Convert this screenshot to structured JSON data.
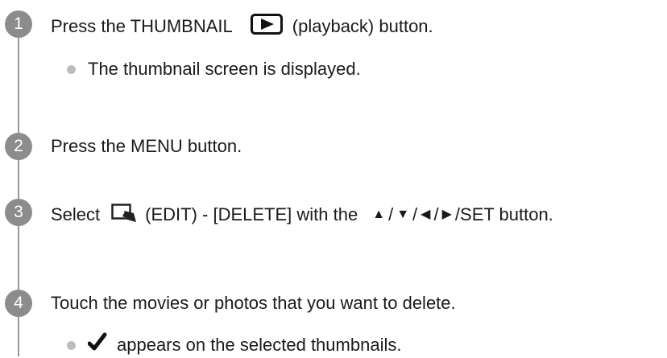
{
  "steps": [
    {
      "number": "1",
      "before": "Press the THUMBNAIL",
      "after": "(playback) button.",
      "note": "The thumbnail screen is displayed."
    },
    {
      "number": "2",
      "text": "Press the MENU button."
    },
    {
      "number": "3",
      "before": "Select",
      "middle": "(EDIT) - [DELETE] with the",
      "sep": "/",
      "after": "/SET button."
    },
    {
      "number": "4",
      "text": "Touch the movies or photos that you want to delete.",
      "note": "appears on the selected thumbnails."
    }
  ],
  "icons": {
    "playback": "playback-button-icon",
    "edit": "edit-icon",
    "arrow_up": "arrow-up-icon",
    "arrow_down": "arrow-down-icon",
    "arrow_left": "arrow-left-icon",
    "arrow_right": "arrow-right-icon",
    "check": "checkmark-icon"
  },
  "colors": {
    "step_circle": "#8c8c8c",
    "timeline": "#9a9a9a",
    "bullet": "#bdbdbd",
    "text": "#1a1a1a"
  }
}
